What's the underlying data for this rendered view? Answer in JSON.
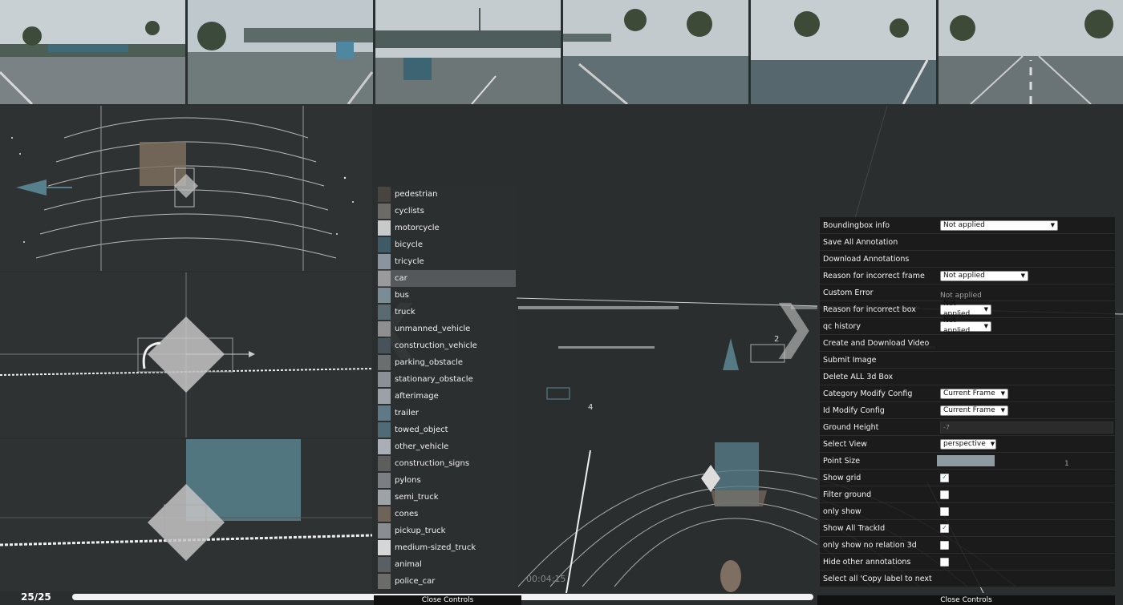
{
  "camera_views": [
    "front-left",
    "front-overpass",
    "front-center",
    "front-right",
    "side-right",
    "rear"
  ],
  "categories": [
    {
      "label": "pedestrian",
      "color": "#4a4440"
    },
    {
      "label": "cyclists",
      "color": "#6b6a66"
    },
    {
      "label": "motorcycle",
      "color": "#c9c9c9"
    },
    {
      "label": "bicycle",
      "color": "#3e5a66"
    },
    {
      "label": "tricycle",
      "color": "#8a93a0"
    },
    {
      "label": "car",
      "color": "#9a9a9a"
    },
    {
      "label": "bus",
      "color": "#7c8c96"
    },
    {
      "label": "truck",
      "color": "#5b6a70"
    },
    {
      "label": "unmanned_vehicle",
      "color": "#8f8f8f"
    },
    {
      "label": "construction_vehicle",
      "color": "#48525a"
    },
    {
      "label": "parking_obstacle",
      "color": "#6a6e6f"
    },
    {
      "label": "stationary_obstacle",
      "color": "#8b9097"
    },
    {
      "label": "afterimage",
      "color": "#9aa2a8"
    },
    {
      "label": "trailer",
      "color": "#5f7a86"
    },
    {
      "label": "towed_object",
      "color": "#4f6b75"
    },
    {
      "label": "other_vehicle",
      "color": "#a9afb5"
    },
    {
      "label": "construction_signs",
      "color": "#5d5e5c"
    },
    {
      "label": "pylons",
      "color": "#7b7e82"
    },
    {
      "label": "semi_truck",
      "color": "#9ea3a9"
    },
    {
      "label": "cones",
      "color": "#6e6358"
    },
    {
      "label": "pickup_truck",
      "color": "#8a8e93"
    },
    {
      "label": "medium-sized_truck",
      "color": "#d6d6d6"
    },
    {
      "label": "animal",
      "color": "#5a5f63"
    },
    {
      "label": "police_car",
      "color": "#6b6c6a"
    }
  ],
  "selected_category": "car",
  "controls": {
    "boundingbox_info": {
      "label": "Boundingbox info",
      "value": "Not applied"
    },
    "save_all": {
      "label": "Save All Annotation"
    },
    "download": {
      "label": "Download Annotations"
    },
    "reason_frame": {
      "label": "Reason for incorrect frame",
      "value": "Not applied"
    },
    "custom_error": {
      "label": "Custom Error",
      "placeholder": "Not applied"
    },
    "reason_box": {
      "label": "Reason for incorrect box",
      "value": "Not applied"
    },
    "qc_history": {
      "label": "qc history",
      "value": "Not applied"
    },
    "create_video": {
      "label": "Create and Download Video"
    },
    "submit_image": {
      "label": "Submit Image"
    },
    "delete_all": {
      "label": "Delete ALL 3d Box"
    },
    "category_modify": {
      "label": "Category Modify Config",
      "value": "Current Frame"
    },
    "id_modify": {
      "label": "Id Modify Config",
      "value": "Current Frame"
    },
    "ground_height": {
      "label": "Ground Height",
      "value": "-7"
    },
    "select_view": {
      "label": "Select View",
      "value": "perspective"
    },
    "point_size": {
      "label": "Point Size",
      "value": "1"
    },
    "show_grid": {
      "label": "Show grid",
      "checked": true
    },
    "filter_ground": {
      "label": "Filter ground",
      "checked": false
    },
    "only_show": {
      "label": "only show",
      "checked": false
    },
    "show_trackid": {
      "label": "Show All TrackId",
      "checked": true
    },
    "no_relation": {
      "label": "only show no relation 3d",
      "checked": false
    },
    "hide_other": {
      "label": "Hide other annotations",
      "checked": false
    },
    "select_copy": {
      "label": "Select all 'Copy label to next"
    }
  },
  "frame_counter": "25/25",
  "timestamp": "00:04:15",
  "close_controls": "Close Controls",
  "track_ids": [
    "2",
    "4"
  ],
  "progress": 1.0
}
